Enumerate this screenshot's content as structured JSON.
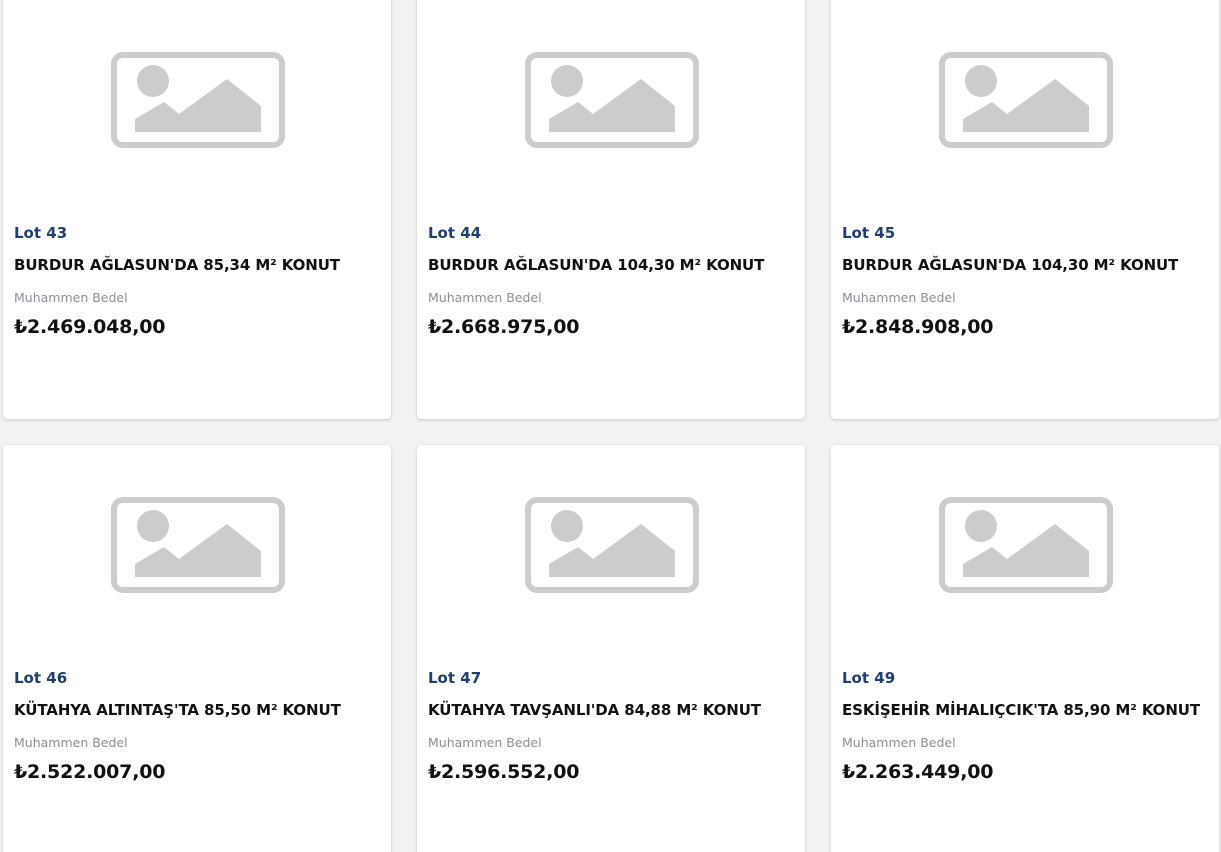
{
  "listings": [
    {
      "lot": "Lot 43",
      "title": "BURDUR AĞLASUN'DA 85,34 M² KONUT",
      "price_label": "Muhammen Bedel",
      "price": "₺2.469.048,00"
    },
    {
      "lot": "Lot 44",
      "title": "BURDUR AĞLASUN'DA 104,30 M² KONUT",
      "price_label": "Muhammen Bedel",
      "price": "₺2.668.975,00"
    },
    {
      "lot": "Lot 45",
      "title": "BURDUR AĞLASUN'DA 104,30 M² KONUT",
      "price_label": "Muhammen Bedel",
      "price": "₺2.848.908,00"
    },
    {
      "lot": "Lot 46",
      "title": "KÜTAHYA ALTINTAŞ'TA 85,50 M² KONUT",
      "price_label": "Muhammen Bedel",
      "price": "₺2.522.007,00"
    },
    {
      "lot": "Lot 47",
      "title": "KÜTAHYA TAVŞANLI'DA 84,88 M² KONUT",
      "price_label": "Muhammen Bedel",
      "price": "₺2.596.552,00"
    },
    {
      "lot": "Lot 49",
      "title": "ESKİŞEHİR MİHALIÇCIK'TA 85,90 M² KONUT",
      "price_label": "Muhammen Bedel",
      "price": "₺2.263.449,00"
    }
  ],
  "placeholder_icon": "image-placeholder-icon",
  "colors": {
    "lot_text": "#1f3f73",
    "placeholder_gray": "#cccccc",
    "page_background": "#f2f2f2"
  }
}
